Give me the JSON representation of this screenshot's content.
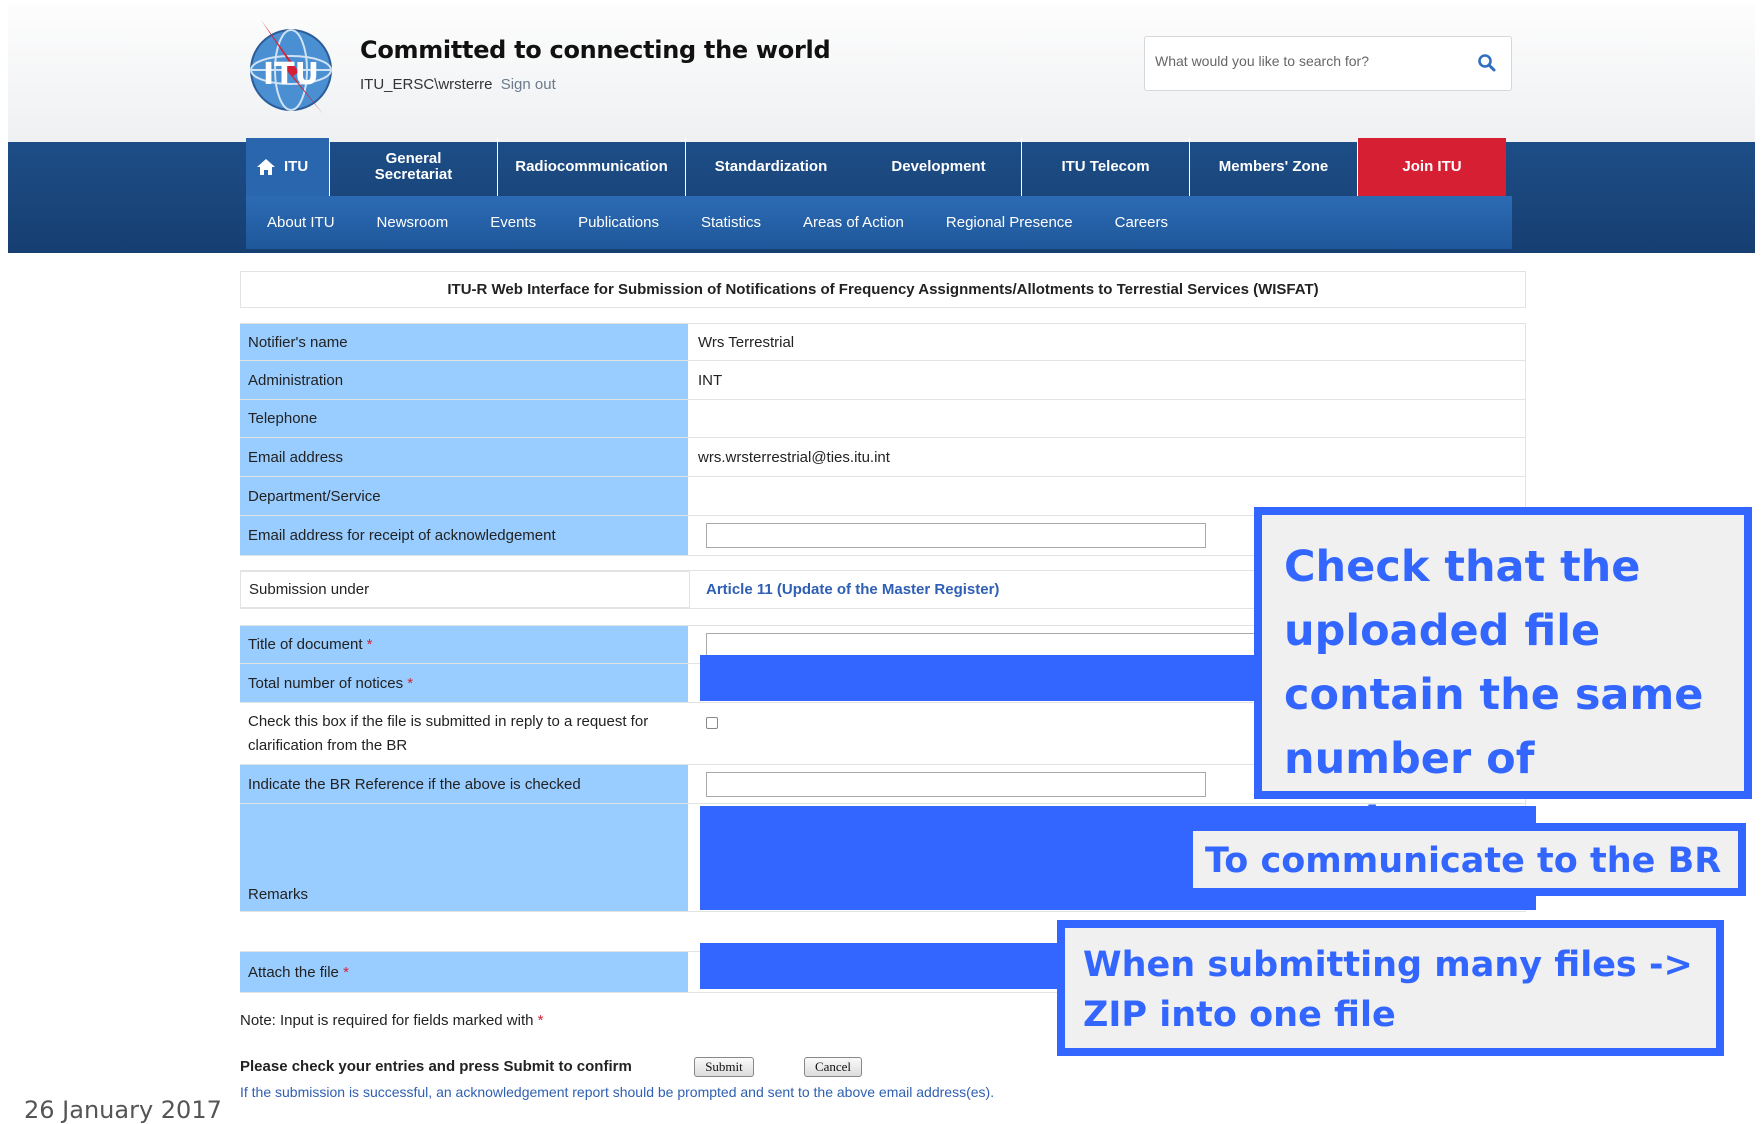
{
  "header": {
    "tagline": "Committed to connecting the world",
    "user": "ITU_ERSC\\wrsterre",
    "sign_out": "Sign out",
    "search_placeholder": "What would you like to search for?",
    "logo_text": "ITU"
  },
  "nav": {
    "main": [
      "ITU",
      "General Secretariat",
      "Radiocommunication",
      "Standardization",
      "Development",
      "ITU Telecom",
      "Members' Zone",
      "Join ITU"
    ],
    "sub": [
      "About ITU",
      "Newsroom",
      "Events",
      "Publications",
      "Statistics",
      "Areas of Action",
      "Regional Presence",
      "Careers"
    ]
  },
  "form": {
    "title": "ITU-R Web Interface for Submission of Notifications of Frequency Assignments/Allotments to Terrestial Services (WISFAT)",
    "notifier_label": "Notifier's name",
    "notifier_value": "Wrs Terrestrial",
    "admin_label": "Administration",
    "admin_value": "INT",
    "telephone_label": "Telephone",
    "telephone_value": "",
    "email_label": "Email address",
    "email_value": "wrs.wrsterrestrial@ties.itu.int",
    "department_label": "Department/Service",
    "department_value": "",
    "ack_email_label": "Email address for receipt of acknowledgement",
    "submission_label": "Submission under",
    "submission_value": "Article 11 (Update of the Master Register)",
    "title_doc_label": "Title of document",
    "total_notices_label": "Total number of notices",
    "clarification_label": "Check this box if the file is submitted in reply to a request for clarification from the BR",
    "br_ref_label": "Indicate the BR Reference if the above is checked",
    "remarks_label": "Remarks",
    "attach_label": "Attach the file",
    "required_mark": "*",
    "note": "Note: Input is required for fields marked with",
    "confirm_text": "Please check your entries and press Submit to confirm",
    "submit": "Submit",
    "cancel": "Cancel",
    "success_text": "If the submission is successful, an acknowledgement report should be prompted and sent to the above email address(es)."
  },
  "callouts": {
    "check_count": "Check that the uploaded file contain the same number of notices",
    "communicate": "To communicate to the BR",
    "zip": "When submitting many files -> ZIP into one file"
  },
  "footer": {
    "date": "26 January 2017"
  },
  "colors": {
    "nav_dark": "#1d4d86",
    "nav_blue": "#2c6bb4",
    "join": "#d71f33",
    "label_blue": "#99ccff",
    "callout": "#3366ff"
  }
}
